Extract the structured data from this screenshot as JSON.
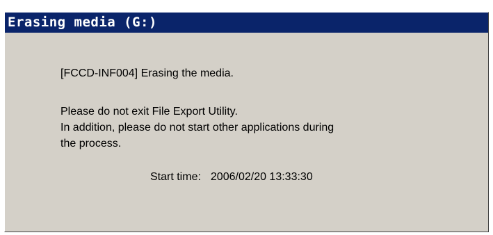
{
  "dialog": {
    "title": "Erasing media (G:)",
    "message_code_line": "[FCCD-INF004] Erasing the media.",
    "warning_lines": [
      "Please do not exit File Export Utility.",
      "In addition, please do not start other applications during",
      "the process."
    ],
    "start_time_label": "Start time:",
    "start_time_value": "2006/02/20 13:33:30"
  },
  "colors": {
    "titlebar": "#0a246a",
    "dialog_background": "#d4d0c8"
  }
}
